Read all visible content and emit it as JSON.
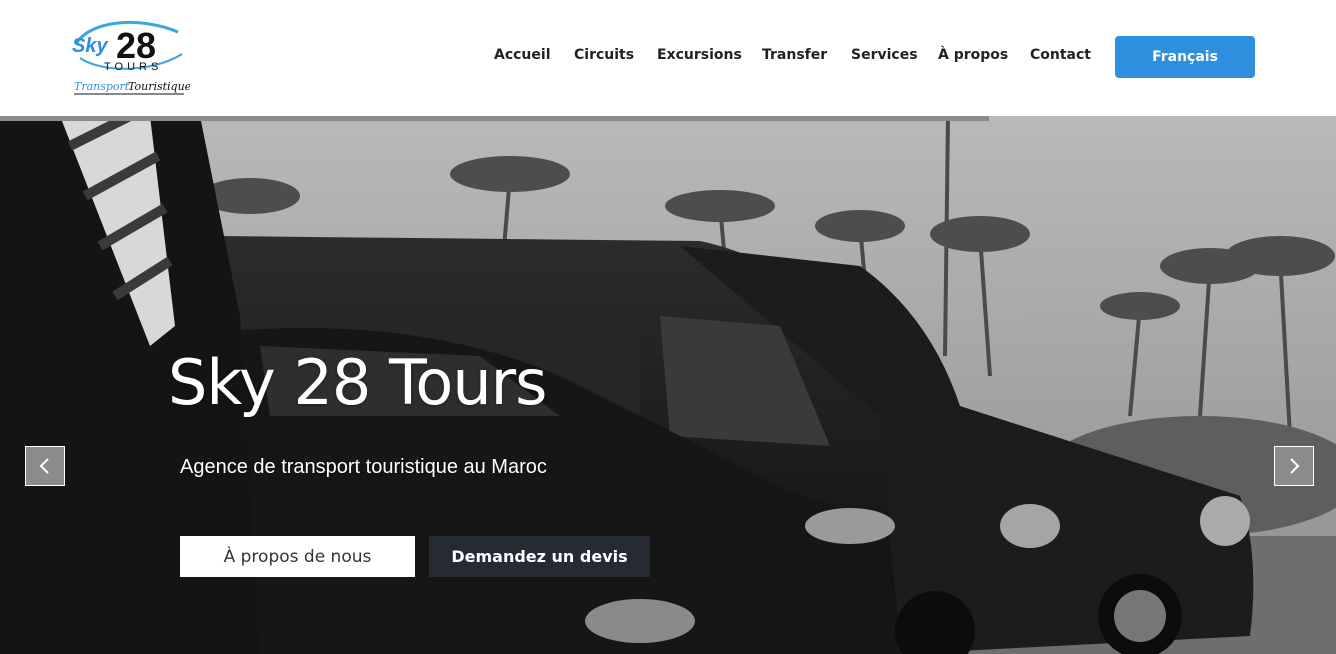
{
  "brand": {
    "logo_number": "28",
    "logo_sky": "Sky",
    "logo_tours": "TOURS",
    "logo_tagline_part1": "Transport",
    "logo_tagline_part2": "Touristique",
    "colors": {
      "accent": "#2d8fdd",
      "dark": "#262a33"
    }
  },
  "nav": {
    "items": [
      {
        "label": "Accueil"
      },
      {
        "label": "Circuits"
      },
      {
        "label": "Excursions"
      },
      {
        "label": "Transfer"
      },
      {
        "label": "Services"
      },
      {
        "label": "À propos"
      },
      {
        "label": "Contact"
      }
    ],
    "language_button": "Français"
  },
  "hero": {
    "title": "Sky 28 Tours",
    "subtitle": "Agence de transport touristique au Maroc",
    "primary_button": "À propos de nous",
    "secondary_button": "Demandez un devis",
    "slide_progress": 0.74,
    "prev_icon": "chevron-left-icon",
    "next_icon": "chevron-right-icon"
  }
}
